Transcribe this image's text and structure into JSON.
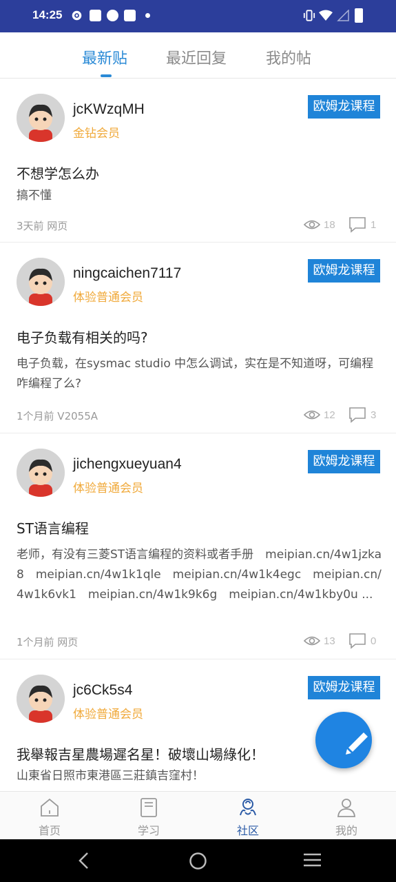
{
  "status_bar": {
    "time": "14:25"
  },
  "tabs": [
    {
      "label": "最新贴",
      "active": true
    },
    {
      "label": "最近回复",
      "active": false
    },
    {
      "label": "我的帖",
      "active": false
    }
  ],
  "posts": [
    {
      "username": "jcKWzqMH",
      "member_level": "金钻会员",
      "course_tag": "欧姆龙课程",
      "title": "不想学怎么办",
      "body": "搞不懂",
      "meta": "3天前 网页",
      "views": "18",
      "comments": "1"
    },
    {
      "username": "ningcaichen7117",
      "member_level": "体验普通会员",
      "course_tag": "欧姆龙课程",
      "title": "电子负载有相关的吗?",
      "body": "电子负载，在sysmac studio 中怎么调试，实在是不知道呀，可编程咋编程了么?",
      "meta": "1个月前 V2055A",
      "views": "12",
      "comments": "3"
    },
    {
      "username": "jichengxueyuan4",
      "member_level": "体验普通会员",
      "course_tag": "欧姆龙课程",
      "title": "ST语言编程",
      "body": "老师，有没有三菱ST语言编程的资料或者手册　meipian.cn/4w1jzka8　meipian.cn/4w1k1qle　meipian.cn/4w1k4egc　meipian.cn/4w1k6vk1　meipian.cn/4w1k9k6g　meipian.cn/4w1kby0u ...",
      "meta": "1个月前 网页",
      "views": "13",
      "comments": "0"
    },
    {
      "username": "jc6Ck5s4",
      "member_level": "体验普通会员",
      "course_tag": "欧姆龙课程",
      "title": "我舉報吉星農場遲名星！破壞山場綠化！",
      "body": "山東省日照市東港區三莊鎮吉窪村！",
      "meta": "",
      "views": "",
      "comments": ""
    }
  ],
  "bottom_nav": [
    {
      "label": "首页",
      "icon": "home-icon",
      "active": false
    },
    {
      "label": "学习",
      "icon": "book-icon",
      "active": false
    },
    {
      "label": "社区",
      "icon": "community-icon",
      "active": true
    },
    {
      "label": "我的",
      "icon": "profile-icon",
      "active": false
    }
  ],
  "colors": {
    "accent": "#2a8ad6",
    "status_bar": "#2c3e9b",
    "course_tag": "#1f84d8",
    "member_level": "#f0a93a",
    "fab": "#1f84e2"
  }
}
